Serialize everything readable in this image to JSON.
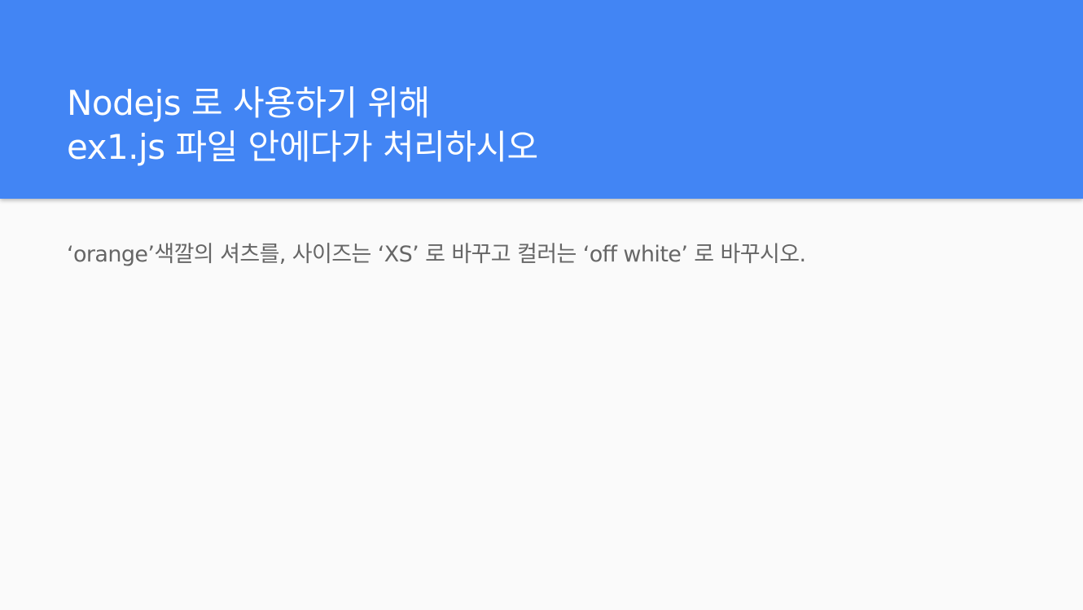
{
  "slide": {
    "title_lines": [
      "Nodejs 로 사용하기 위해",
      "ex1.js 파일 안에다가 처리하시오"
    ],
    "body": "‘orange’색깔의 셔츠를, 사이즈는 ‘XS’ 로 바꾸고 컬러는 ‘off white’ 로 바꾸시오."
  },
  "colors": {
    "header_background": "#4285f4",
    "title_text": "#ffffff",
    "body_text": "#666666",
    "page_background": "#fafafa"
  }
}
